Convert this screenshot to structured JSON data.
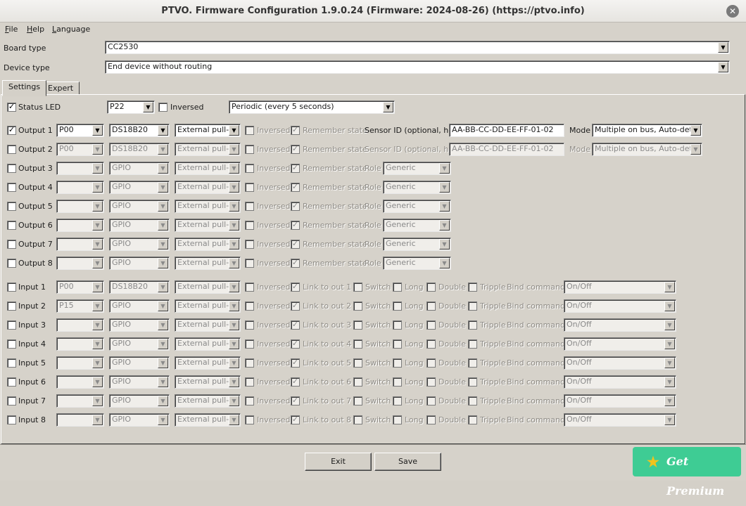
{
  "window": {
    "title": "PTVO. Firmware Configuration 1.9.0.24 (Firmware: 2024-08-26) (https://ptvo.info)"
  },
  "menu": [
    {
      "key": "F",
      "rest": "ile"
    },
    {
      "key": "H",
      "rest": "elp"
    },
    {
      "key": "L",
      "rest": "anguage"
    }
  ],
  "board": {
    "label": "Board type",
    "value": "CC2530"
  },
  "device": {
    "label": "Device type",
    "value": "End device without routing"
  },
  "tabs": [
    "Settings",
    "Expert"
  ],
  "status_led": {
    "label": "Status LED",
    "checked": true,
    "pin": "P22",
    "inversed_label": "Inversed",
    "inversed": false,
    "mode": "Periodic (every 5 seconds)"
  },
  "outputs": [
    {
      "label": "Output 1",
      "enabled": true,
      "pin": "P00",
      "type": "DS18B20",
      "pull": "External pull-up",
      "inversed": "Inversed",
      "remember": "Remember state",
      "extra_label": "Sensor ID (optional, hex)",
      "extra_value": "AA-BB-CC-DD-EE-FF-01-02",
      "mode_label": "Mode",
      "mode_value": "Multiple on bus, Auto-detect"
    },
    {
      "label": "Output 2",
      "enabled": false,
      "pin": "P00",
      "type": "DS18B20",
      "pull": "External pull-up",
      "inversed": "Inversed",
      "remember": "Remember state",
      "extra_label": "Sensor ID (optional, hex)",
      "extra_value": "AA-BB-CC-DD-EE-FF-01-02",
      "mode_label": "Mode",
      "mode_value": "Multiple on bus, Auto-detect"
    },
    {
      "label": "Output 3",
      "enabled": false,
      "pin": "",
      "type": "GPIO",
      "pull": "External pull-up",
      "inversed": "Inversed",
      "remember": "Remember state",
      "role_label": "Role",
      "role_value": "Generic"
    },
    {
      "label": "Output 4",
      "enabled": false,
      "pin": "",
      "type": "GPIO",
      "pull": "External pull-up",
      "inversed": "Inversed",
      "remember": "Remember state",
      "role_label": "Role",
      "role_value": "Generic"
    },
    {
      "label": "Output 5",
      "enabled": false,
      "pin": "",
      "type": "GPIO",
      "pull": "External pull-up",
      "inversed": "Inversed",
      "remember": "Remember state",
      "role_label": "Role",
      "role_value": "Generic"
    },
    {
      "label": "Output 6",
      "enabled": false,
      "pin": "",
      "type": "GPIO",
      "pull": "External pull-up",
      "inversed": "Inversed",
      "remember": "Remember state",
      "role_label": "Role",
      "role_value": "Generic"
    },
    {
      "label": "Output 7",
      "enabled": false,
      "pin": "",
      "type": "GPIO",
      "pull": "External pull-up",
      "inversed": "Inversed",
      "remember": "Remember state",
      "role_label": "Role",
      "role_value": "Generic"
    },
    {
      "label": "Output 8",
      "enabled": false,
      "pin": "",
      "type": "GPIO",
      "pull": "External pull-up",
      "inversed": "Inversed",
      "remember": "Remember state",
      "role_label": "Role",
      "role_value": "Generic"
    }
  ],
  "inputs": [
    {
      "label": "Input 1",
      "pin": "P00",
      "type": "DS18B20",
      "pull": "External pull-up",
      "inversed": "Inversed",
      "link": "Link to out 1",
      "switch": "Switch",
      "long": "Long",
      "double": "Double",
      "tripple": "Tripple",
      "bind_label": "Bind command",
      "bind_value": "On/Off"
    },
    {
      "label": "Input 2",
      "pin": "P15",
      "type": "GPIO",
      "pull": "External pull-up",
      "inversed": "Inversed",
      "link": "Link to out 2",
      "switch": "Switch",
      "long": "Long",
      "double": "Double",
      "tripple": "Tripple",
      "bind_label": "Bind command",
      "bind_value": "On/Off"
    },
    {
      "label": "Input 3",
      "pin": "",
      "type": "GPIO",
      "pull": "External pull-up",
      "inversed": "Inversed",
      "link": "Link to out 3",
      "switch": "Switch",
      "long": "Long",
      "double": "Double",
      "tripple": "Tripple",
      "bind_label": "Bind command",
      "bind_value": "On/Off"
    },
    {
      "label": "Input 4",
      "pin": "",
      "type": "GPIO",
      "pull": "External pull-up",
      "inversed": "Inversed",
      "link": "Link to out 4",
      "switch": "Switch",
      "long": "Long",
      "double": "Double",
      "tripple": "Tripple",
      "bind_label": "Bind command",
      "bind_value": "On/Off"
    },
    {
      "label": "Input 5",
      "pin": "",
      "type": "GPIO",
      "pull": "External pull-up",
      "inversed": "Inversed",
      "link": "Link to out 5",
      "switch": "Switch",
      "long": "Long",
      "double": "Double",
      "tripple": "Tripple",
      "bind_label": "Bind command",
      "bind_value": "On/Off"
    },
    {
      "label": "Input 6",
      "pin": "",
      "type": "GPIO",
      "pull": "External pull-up",
      "inversed": "Inversed",
      "link": "Link to out 6",
      "switch": "Switch",
      "long": "Long",
      "double": "Double",
      "tripple": "Tripple",
      "bind_label": "Bind command",
      "bind_value": "On/Off"
    },
    {
      "label": "Input 7",
      "pin": "",
      "type": "GPIO",
      "pull": "External pull-up",
      "inversed": "Inversed",
      "link": "Link to out 7",
      "switch": "Switch",
      "long": "Long",
      "double": "Double",
      "tripple": "Tripple",
      "bind_label": "Bind command",
      "bind_value": "On/Off"
    },
    {
      "label": "Input 8",
      "pin": "",
      "type": "GPIO",
      "pull": "External pull-up",
      "inversed": "Inversed",
      "link": "Link to out 8",
      "switch": "Switch",
      "long": "Long",
      "double": "Double",
      "tripple": "Tripple",
      "bind_label": "Bind command",
      "bind_value": "On/Off"
    }
  ],
  "buttons": {
    "exit": "Exit",
    "save": "Save",
    "premium": "Get Premium"
  },
  "icons": {
    "close": "close-icon",
    "dropdown": "chevron-down-icon",
    "check": "check-icon",
    "premium": "star-icon"
  },
  "colors": {
    "premium_bg": "#3ecc94",
    "premium_star": "#f2c31c"
  }
}
